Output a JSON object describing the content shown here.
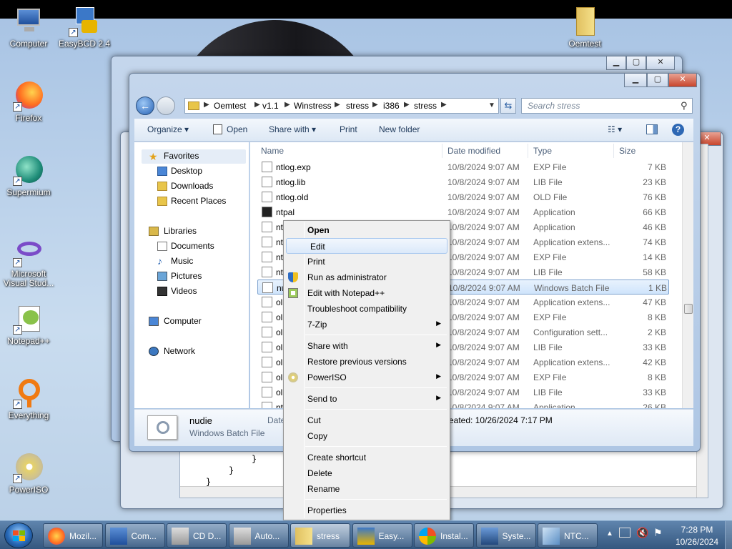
{
  "desktop": {
    "icons": [
      {
        "label": "Computer",
        "icon": "computer-icon"
      },
      {
        "label": "EasyBCD 2.4",
        "icon": "easybcd-icon"
      },
      {
        "label": "Oemtest",
        "icon": "folder-icon"
      },
      {
        "label": "Firefox",
        "icon": "firefox-icon"
      },
      {
        "label": "Supermium",
        "icon": "supermium-icon"
      },
      {
        "label": "Microsoft Visual Stud...",
        "icon": "visual-studio-icon"
      },
      {
        "label": "Notepad++",
        "icon": "notepadpp-icon"
      },
      {
        "label": "Everything",
        "icon": "everything-icon"
      },
      {
        "label": "PowerISO",
        "icon": "poweriso-icon"
      }
    ]
  },
  "editor_snippet": [
    "}",
    "}",
    "}"
  ],
  "explorer": {
    "breadcrumb": [
      "Oemtest",
      "v1.1",
      "Winstress",
      "stress",
      "i386",
      "stress"
    ],
    "search_placeholder": "Search stress",
    "toolbar": {
      "organize": "Organize",
      "open": "Open",
      "share_with": "Share with",
      "print": "Print",
      "new_folder": "New folder"
    },
    "nav": {
      "favorites": "Favorites",
      "desktop": "Desktop",
      "downloads": "Downloads",
      "recent": "Recent Places",
      "libraries": "Libraries",
      "documents": "Documents",
      "music": "Music",
      "pictures": "Pictures",
      "videos": "Videos",
      "computer": "Computer",
      "network": "Network"
    },
    "columns": {
      "name": "Name",
      "date": "Date modified",
      "type": "Type",
      "size": "Size"
    },
    "files": [
      {
        "name": "ntlog.exp",
        "date": "10/8/2024 9:07 AM",
        "type": "EXP File",
        "size": "7 KB"
      },
      {
        "name": "ntlog.lib",
        "date": "10/8/2024 9:07 AM",
        "type": "LIB File",
        "size": "23 KB"
      },
      {
        "name": "ntlog.old",
        "date": "10/8/2024 9:07 AM",
        "type": "OLD File",
        "size": "76 KB"
      },
      {
        "name": "ntpal",
        "date": "10/8/2024 9:07 AM",
        "type": "Application",
        "size": "66 KB"
      },
      {
        "name": "nt",
        "date": "10/8/2024 9:07 AM",
        "type": "Application",
        "size": "46 KB"
      },
      {
        "name": "nt",
        "date": "10/8/2024 9:07 AM",
        "type": "Application extens...",
        "size": "74 KB"
      },
      {
        "name": "nt",
        "date": "10/8/2024 9:07 AM",
        "type": "EXP File",
        "size": "14 KB"
      },
      {
        "name": "nt",
        "date": "10/8/2024 9:07 AM",
        "type": "LIB File",
        "size": "58 KB"
      },
      {
        "name": "nu",
        "date": "10/8/2024 9:07 AM",
        "type": "Windows Batch File",
        "size": "1 KB"
      },
      {
        "name": "ol",
        "date": "10/8/2024 9:07 AM",
        "type": "Application extens...",
        "size": "47 KB"
      },
      {
        "name": "ol",
        "date": "10/8/2024 9:07 AM",
        "type": "EXP File",
        "size": "8 KB"
      },
      {
        "name": "ol",
        "date": "10/8/2024 9:07 AM",
        "type": "Configuration sett...",
        "size": "2 KB"
      },
      {
        "name": "ol",
        "date": "10/8/2024 9:07 AM",
        "type": "LIB File",
        "size": "33 KB"
      },
      {
        "name": "ol",
        "date": "10/8/2024 9:07 AM",
        "type": "Application extens...",
        "size": "42 KB"
      },
      {
        "name": "ol",
        "date": "10/8/2024 9:07 AM",
        "type": "EXP File",
        "size": "8 KB"
      },
      {
        "name": "ol",
        "date": "10/8/2024 9:07 AM",
        "type": "LIB File",
        "size": "33 KB"
      },
      {
        "name": "nt",
        "date": "10/8/2024 9:07 AM",
        "type": "Application",
        "size": "26 KB"
      }
    ],
    "selected_index": 8,
    "details": {
      "name": "nudie",
      "type": "Windows Batch File",
      "date_label": "Date",
      "created": "eated: 10/26/2024 7:17 PM"
    }
  },
  "context_menu": [
    {
      "label": "Open",
      "bold": true
    },
    {
      "label": "Edit",
      "highlighted": true
    },
    {
      "label": "Print"
    },
    {
      "label": "Run as administrator",
      "icon": "shield-icon"
    },
    {
      "label": "Edit with Notepad++",
      "icon": "notepadpp-icon"
    },
    {
      "label": "Troubleshoot compatibility"
    },
    {
      "label": "7-Zip",
      "submenu": true
    },
    {
      "separator": true
    },
    {
      "label": "Share with",
      "submenu": true
    },
    {
      "label": "Restore previous versions"
    },
    {
      "label": "PowerISO",
      "submenu": true,
      "icon": "poweriso-icon"
    },
    {
      "separator": true
    },
    {
      "label": "Send to",
      "submenu": true
    },
    {
      "separator": true
    },
    {
      "label": "Cut"
    },
    {
      "label": "Copy"
    },
    {
      "separator": true
    },
    {
      "label": "Create shortcut"
    },
    {
      "label": "Delete"
    },
    {
      "label": "Rename"
    },
    {
      "separator": true
    },
    {
      "label": "Properties"
    }
  ],
  "taskbar": {
    "buttons": [
      {
        "label": "Mozil...",
        "icon": "firefox-icon"
      },
      {
        "label": "Com...",
        "icon": "computer-icon"
      },
      {
        "label": "CD D...",
        "icon": "cd-drive-icon"
      },
      {
        "label": "Auto...",
        "icon": "cd-drive-icon"
      },
      {
        "label": "stress",
        "icon": "folder-icon",
        "active": true
      },
      {
        "label": "Easy...",
        "icon": "easybcd-icon"
      },
      {
        "label": "Instal...",
        "icon": "windows-icon"
      },
      {
        "label": "Syste...",
        "icon": "system-icon"
      },
      {
        "label": "NTC...",
        "icon": "ntc-icon"
      }
    ],
    "time": "7:28 PM",
    "date": "10/26/2024"
  },
  "colors": {
    "accent": "#3a6ea5",
    "selection": "#cfe4fb",
    "taskbar": "#34577f"
  }
}
